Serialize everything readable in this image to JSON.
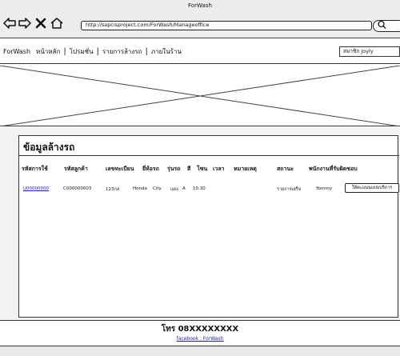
{
  "browser": {
    "window_title": "ForWash",
    "url": "http://sapcisproject.com/ForWash/Manageoffice",
    "icons": [
      "back-icon",
      "forward-icon",
      "close-icon",
      "home-icon",
      "search-icon"
    ]
  },
  "nav": {
    "brand": "ForWash",
    "items": [
      "หน้าหลัก",
      "โปรมชั่น",
      "รายการล้างรถ",
      "ภายในร้าน"
    ],
    "user_label": "สมาชิก  Joyly"
  },
  "section": {
    "title": "ข้อมูลล้างรถ"
  },
  "table": {
    "headers": [
      "รหัสการใช้",
      "รหัสลูกค้า",
      "เลขทะเบียน",
      "ยี่ห้อรถ",
      "รุ่นรถ",
      "สี",
      "โซน",
      "เวลา",
      "หมายเหตุ",
      "สถานะ",
      "พนักงานที่รับผิดชอบ"
    ],
    "rows": [
      {
        "order_id": "U00000000",
        "customer_id": "C000000003",
        "plate": "123กล",
        "brand": "Honda",
        "model": "City",
        "color": "แดง",
        "zone": "A",
        "time": "10.30",
        "status": "รายการเสร็จ",
        "staff": "Yommy",
        "action_label": "ให้คะแนนแบบบริการ"
      }
    ]
  },
  "footer": {
    "phone": "โทร 08XXXXXXXX",
    "facebook": "facebook : ForWash"
  }
}
